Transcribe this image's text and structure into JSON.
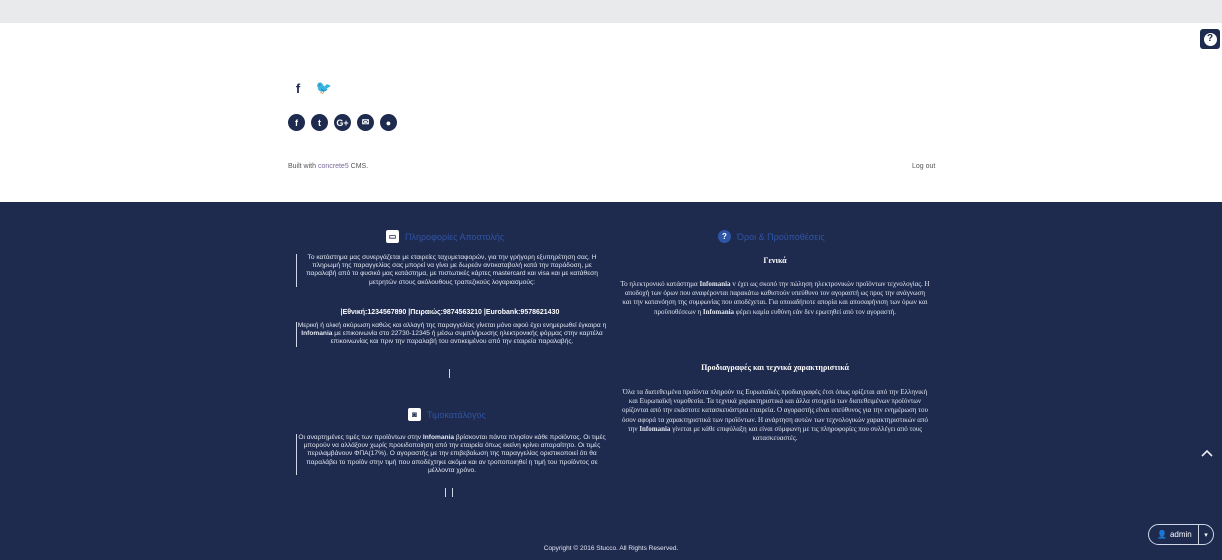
{
  "header": {
    "help_icon": "?"
  },
  "social_plain": [
    {
      "name": "facebook-icon",
      "glyph": "f"
    },
    {
      "name": "twitter-icon",
      "glyph": "🐦"
    }
  ],
  "social_round": [
    {
      "name": "facebook-circle-icon",
      "glyph": "f"
    },
    {
      "name": "twitter-circle-icon",
      "glyph": "t"
    },
    {
      "name": "googleplus-circle-icon",
      "glyph": "G+"
    },
    {
      "name": "email-circle-icon",
      "glyph": "✉"
    },
    {
      "name": "reddit-circle-icon",
      "glyph": "●"
    }
  ],
  "site_footer": {
    "built_prefix": "Built with ",
    "built_brand": "concrete5",
    "built_suffix": " CMS.",
    "logout": "Log out"
  },
  "shipping": {
    "title": "Πληροφορίες Αποστολής",
    "text": "Το κατάστημα μας συνεργάζεται με εταιρείες ταχυμεταφορών, για την γρήγορη εξυπηρέτηση σας. Η πληρωμή της παραγγελίας σας μπορεί να γίνει με δωρεάν αντικαταβολή κατά την παράδοση, με παραλαβή από το φυσικό μας κατάστημα, με πιστωτικές κάρτες mastercard και visa και με κατάθεση μετρητών στους ακόλουθους τραπεζικούς λογαριασμούς:",
    "banks": "|Εθνική:1234567890 |Πειραιώς:9874563210 |Eurobank:9578621430",
    "text2_pre": "Μερική ή ολική ακύρωση καθώς και αλλαγή της παραγγελίας γίνεται μόνο αφού έχει ενημερωθεί έγκαιρα η ",
    "brand": "Infomania",
    "text2_post": " με επικοινωνία στο 22730-12345 ή μέσω συμπλήρωσης ηλεκτρονικής φόρμας στην καρτέλα επικοινωνίας και πριν την παραλαβή του αντικειμένου από την εταιρεία παραλαβής."
  },
  "pricelist": {
    "title": "Τιμοκατάλογος",
    "text_pre": "Οι αναρτημένες τιμές των προϊόντων στην ",
    "brand": "Infomania",
    "text_post": " βρίσκονται πάντα πλησίον κάθε προϊόντος. Οι τιμές μπορούν να αλλάξουν χωρίς προειδοποίηση από την εταιρεία όπως εκείνη κρίνει απαραίτητο. Οι τιμές περιλαμβάνουν ΦΠΑ(17%). Ο αγοραστής με την επιβεβαίωση της παραγγελίας οριστικοποιεί ότι θα παραλάβει το προϊόν στην τιμή που αποδέχτηκε ακόμα και αν τροποποιηθεί η τιμή του προϊόντος σε μέλλοντα χρόνο."
  },
  "terms": {
    "title": "Όροι & Προϋποθέσεις",
    "general_heading": "Γενικά",
    "general_pre": "Το ηλεκτρονικό κατάστημα ",
    "brand": "Infomania",
    "general_mid": "  v έχει ως σκοπό την πώληση ηλεκτρονικών προϊόντων τεχνολογίας. Η αποδοχή των όρων που αναφέρονται παρακάτω καθιστούν υπεύθυνο τον αγοραστή ως προς την ανάγνωση και την κατανόηση της συμφωνίας που αποδέχεται.  Για οποιαδήποτε απορία και αποσαφήνιση των όρων και προϋποθέσεων η ",
    "general_post": " φέρει καμία ευθύνη εάν δεν ερωτηθεί από τον αγοραστή.",
    "spec_heading": "Προδιαγραφές και τεχνικά χαρακτηριστικά",
    "spec_pre": "Όλα τα διατεθειμένα προϊόντα πληρούν τις Ευρωπαϊκές προδιαγραφές έτσι όπως ορίζεται από την Ελληνική και Ευρωπαϊκή νομοθεσία. Τα τεχνικά χαρακτηριστικά και άλλα στοιχεία των διατεθειμένων προϊόντων ορίζονται από την εκάστοτε κατασκευάστρια εταιρεία. Ο αγοραστής είναι υπεύθυνος για την ενημέρωση του όσον αφορά τα χαρακτηριστικά των προϊόντων. Η ανάρτηση αυτών των τεχνολογικών χαρακτηριστικών από την ",
    "spec_post": " γίνεται με κάθε επιφύλαξη και είναι σύμφωνη με τις πληροφορίες που συλλέγει από τους κατασκευαστές."
  },
  "admin": {
    "label": "admin",
    "caret": "▾"
  },
  "copyright": "Copyright © 2016 Stucco. All Rights Reserved."
}
